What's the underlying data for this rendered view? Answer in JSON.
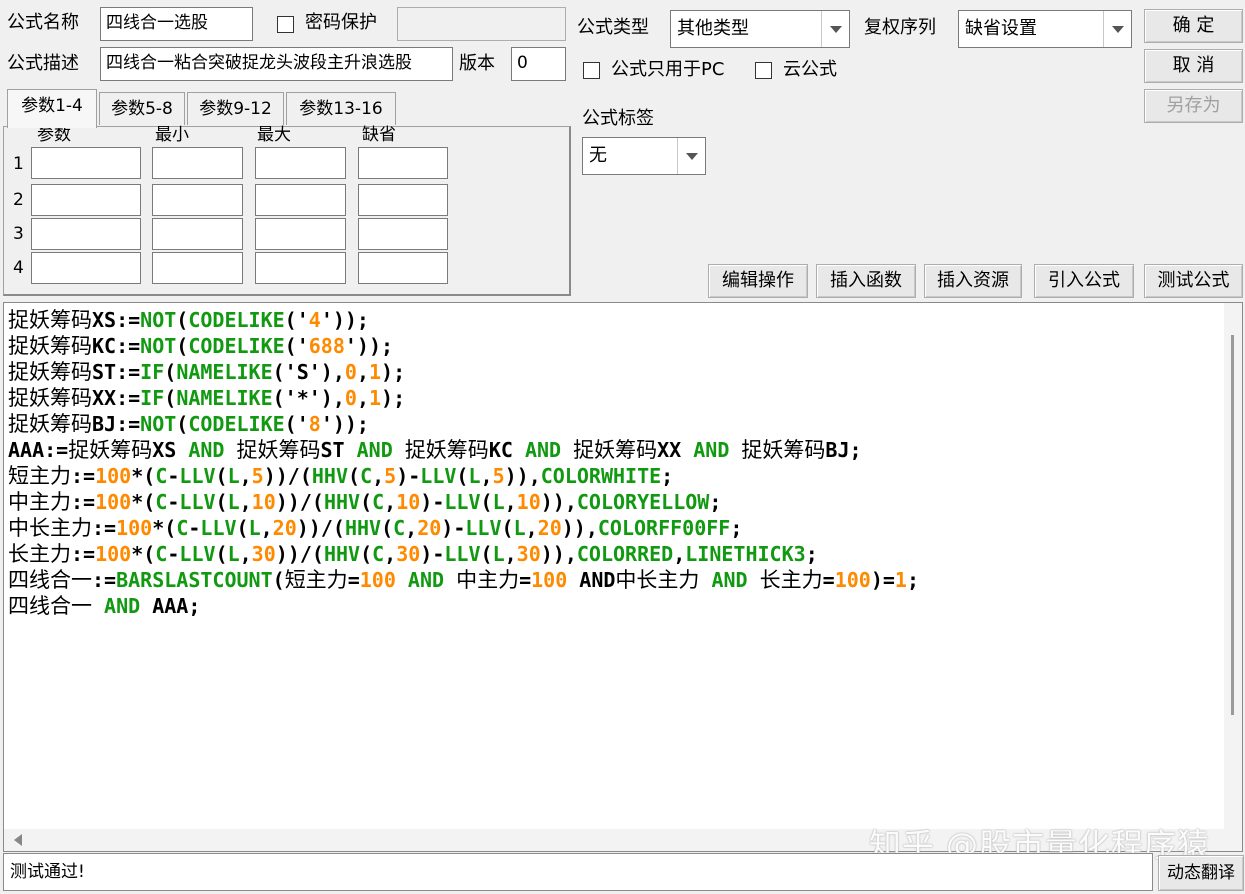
{
  "header": {
    "formula_name_label": "公式名称",
    "formula_name_value": "四线合一选股",
    "password_label": "密码保护",
    "formula_desc_label": "公式描述",
    "formula_desc_value": "四线合一粘合突破捉龙头波段主升浪选股",
    "version_label": "版本",
    "version_value": "0",
    "formula_type_label": "公式类型",
    "formula_type_value": "其他类型",
    "restoration_label": "复权序列",
    "restoration_value": "缺省设置",
    "pc_only_label": "公式只用于PC",
    "cloud_label": "云公式",
    "tag_label": "公式标签",
    "tag_value": "无"
  },
  "buttons": {
    "ok": "确 定",
    "cancel": "取 消",
    "save_as": "另存为",
    "edit_ops": "编辑操作",
    "insert_func": "插入函数",
    "insert_res": "插入资源",
    "import_formula": "引入公式",
    "test_formula": "测试公式",
    "dynamic_translate": "动态翻译"
  },
  "tabs": [
    "参数1-4",
    "参数5-8",
    "参数9-12",
    "参数13-16"
  ],
  "param_table": {
    "headers": [
      "参数",
      "最小",
      "最大",
      "缺省"
    ],
    "rows": [
      "1",
      "2",
      "3",
      "4"
    ]
  },
  "code_lines": [
    [
      [
        "cn",
        "捉妖筹码"
      ],
      [
        "t",
        "XS:="
      ],
      [
        "fn",
        "NOT"
      ],
      [
        "t",
        "("
      ],
      [
        "fn",
        "CODELIKE"
      ],
      [
        "t",
        "('"
      ],
      [
        "num",
        "4"
      ],
      [
        "t",
        "'));"
      ]
    ],
    [
      [
        "cn",
        "捉妖筹码"
      ],
      [
        "t",
        "KC:="
      ],
      [
        "fn",
        "NOT"
      ],
      [
        "t",
        "("
      ],
      [
        "fn",
        "CODELIKE"
      ],
      [
        "t",
        "('"
      ],
      [
        "num",
        "688"
      ],
      [
        "t",
        "'));"
      ]
    ],
    [
      [
        "cn",
        "捉妖筹码"
      ],
      [
        "t",
        "ST:="
      ],
      [
        "fn",
        "IF"
      ],
      [
        "t",
        "("
      ],
      [
        "fn",
        "NAMELIKE"
      ],
      [
        "t",
        "('S'),"
      ],
      [
        "num",
        "0"
      ],
      [
        "t",
        ","
      ],
      [
        "num",
        "1"
      ],
      [
        "t",
        ");"
      ]
    ],
    [
      [
        "cn",
        "捉妖筹码"
      ],
      [
        "t",
        "XX:="
      ],
      [
        "fn",
        "IF"
      ],
      [
        "t",
        "("
      ],
      [
        "fn",
        "NAMELIKE"
      ],
      [
        "t",
        "('*'),"
      ],
      [
        "num",
        "0"
      ],
      [
        "t",
        ","
      ],
      [
        "num",
        "1"
      ],
      [
        "t",
        ");"
      ]
    ],
    [
      [
        "cn",
        "捉妖筹码"
      ],
      [
        "t",
        "BJ:="
      ],
      [
        "fn",
        "NOT"
      ],
      [
        "t",
        "("
      ],
      [
        "fn",
        "CODELIKE"
      ],
      [
        "t",
        "('"
      ],
      [
        "num",
        "8"
      ],
      [
        "t",
        "'));"
      ]
    ],
    [
      [
        "t",
        "AAA:="
      ],
      [
        "cn",
        "捉妖筹码"
      ],
      [
        "t",
        "XS "
      ],
      [
        "fn",
        "AND"
      ],
      [
        "t",
        " "
      ],
      [
        "cn",
        "捉妖筹码"
      ],
      [
        "t",
        "ST "
      ],
      [
        "fn",
        "AND"
      ],
      [
        "t",
        " "
      ],
      [
        "cn",
        "捉妖筹码"
      ],
      [
        "t",
        "KC "
      ],
      [
        "fn",
        "AND"
      ],
      [
        "t",
        " "
      ],
      [
        "cn",
        "捉妖筹码"
      ],
      [
        "t",
        "XX "
      ],
      [
        "fn",
        "AND"
      ],
      [
        "t",
        " "
      ],
      [
        "cn",
        "捉妖筹码"
      ],
      [
        "t",
        "BJ;"
      ]
    ],
    [
      [
        "cn",
        "短主力"
      ],
      [
        "t",
        ":="
      ],
      [
        "num",
        "100"
      ],
      [
        "t",
        "*("
      ],
      [
        "fn",
        "C"
      ],
      [
        "t",
        "-"
      ],
      [
        "fn",
        "LLV"
      ],
      [
        "t",
        "("
      ],
      [
        "fn",
        "L"
      ],
      [
        "t",
        ","
      ],
      [
        "num",
        "5"
      ],
      [
        "t",
        "))/("
      ],
      [
        "fn",
        "HHV"
      ],
      [
        "t",
        "("
      ],
      [
        "fn",
        "C"
      ],
      [
        "t",
        ","
      ],
      [
        "num",
        "5"
      ],
      [
        "t",
        ")-"
      ],
      [
        "fn",
        "LLV"
      ],
      [
        "t",
        "("
      ],
      [
        "fn",
        "L"
      ],
      [
        "t",
        ","
      ],
      [
        "num",
        "5"
      ],
      [
        "t",
        "))"
      ],
      [
        "t",
        ","
      ],
      [
        "fn",
        "COLORWHITE"
      ],
      [
        "t",
        ";"
      ]
    ],
    [
      [
        "cn",
        "中主力"
      ],
      [
        "t",
        ":="
      ],
      [
        "num",
        "100"
      ],
      [
        "t",
        "*("
      ],
      [
        "fn",
        "C"
      ],
      [
        "t",
        "-"
      ],
      [
        "fn",
        "LLV"
      ],
      [
        "t",
        "("
      ],
      [
        "fn",
        "L"
      ],
      [
        "t",
        ","
      ],
      [
        "num",
        "10"
      ],
      [
        "t",
        "))/("
      ],
      [
        "fn",
        "HHV"
      ],
      [
        "t",
        "("
      ],
      [
        "fn",
        "C"
      ],
      [
        "t",
        ","
      ],
      [
        "num",
        "10"
      ],
      [
        "t",
        ")-"
      ],
      [
        "fn",
        "LLV"
      ],
      [
        "t",
        "("
      ],
      [
        "fn",
        "L"
      ],
      [
        "t",
        ","
      ],
      [
        "num",
        "10"
      ],
      [
        "t",
        "))"
      ],
      [
        "t",
        ","
      ],
      [
        "fn",
        "COLORYELLOW"
      ],
      [
        "t",
        ";"
      ]
    ],
    [
      [
        "cn",
        "中长主力"
      ],
      [
        "t",
        ":="
      ],
      [
        "num",
        "100"
      ],
      [
        "t",
        "*("
      ],
      [
        "fn",
        "C"
      ],
      [
        "t",
        "-"
      ],
      [
        "fn",
        "LLV"
      ],
      [
        "t",
        "("
      ],
      [
        "fn",
        "L"
      ],
      [
        "t",
        ","
      ],
      [
        "num",
        "20"
      ],
      [
        "t",
        "))/("
      ],
      [
        "fn",
        "HHV"
      ],
      [
        "t",
        "("
      ],
      [
        "fn",
        "C"
      ],
      [
        "t",
        ","
      ],
      [
        "num",
        "20"
      ],
      [
        "t",
        ")-"
      ],
      [
        "fn",
        "LLV"
      ],
      [
        "t",
        "("
      ],
      [
        "fn",
        "L"
      ],
      [
        "t",
        ","
      ],
      [
        "num",
        "20"
      ],
      [
        "t",
        "))"
      ],
      [
        "t",
        ","
      ],
      [
        "fn",
        "COLORFF00FF"
      ],
      [
        "t",
        ";"
      ]
    ],
    [
      [
        "cn",
        "长主力"
      ],
      [
        "t",
        ":="
      ],
      [
        "num",
        "100"
      ],
      [
        "t",
        "*("
      ],
      [
        "fn",
        "C"
      ],
      [
        "t",
        "-"
      ],
      [
        "fn",
        "LLV"
      ],
      [
        "t",
        "("
      ],
      [
        "fn",
        "L"
      ],
      [
        "t",
        ","
      ],
      [
        "num",
        "30"
      ],
      [
        "t",
        "))/("
      ],
      [
        "fn",
        "HHV"
      ],
      [
        "t",
        "("
      ],
      [
        "fn",
        "C"
      ],
      [
        "t",
        ","
      ],
      [
        "num",
        "30"
      ],
      [
        "t",
        ")-"
      ],
      [
        "fn",
        "LLV"
      ],
      [
        "t",
        "("
      ],
      [
        "fn",
        "L"
      ],
      [
        "t",
        ","
      ],
      [
        "num",
        "30"
      ],
      [
        "t",
        "))"
      ],
      [
        "t",
        ","
      ],
      [
        "fn",
        "COLORRED"
      ],
      [
        "t",
        ","
      ],
      [
        "fn",
        "LINETHICK3"
      ],
      [
        "t",
        ";"
      ]
    ],
    [
      [
        "cn",
        "四线合一"
      ],
      [
        "t",
        ":="
      ],
      [
        "fn",
        "BARSLASTCOUNT"
      ],
      [
        "t",
        "("
      ],
      [
        "cn",
        "短主力"
      ],
      [
        "t",
        "="
      ],
      [
        "num",
        "100"
      ],
      [
        "t",
        " "
      ],
      [
        "fn",
        "AND"
      ],
      [
        "t",
        " "
      ],
      [
        "cn",
        "中主力"
      ],
      [
        "t",
        "="
      ],
      [
        "num",
        "100"
      ],
      [
        "t",
        " AND"
      ],
      [
        "cn",
        "中长主力"
      ],
      [
        "t",
        " "
      ],
      [
        "fn",
        "AND"
      ],
      [
        "t",
        " "
      ],
      [
        "cn",
        "长主力"
      ],
      [
        "t",
        "="
      ],
      [
        "num",
        "100"
      ],
      [
        "t",
        ")="
      ],
      [
        "num",
        "1"
      ],
      [
        "t",
        ";"
      ]
    ],
    [
      [
        "cn",
        "四线合一"
      ],
      [
        "t",
        " "
      ],
      [
        "fn",
        "AND"
      ],
      [
        "t",
        " AAA;"
      ]
    ]
  ],
  "watermark": "知乎 @股市量化程序猿",
  "status": "测试通过!",
  "colors": {
    "function": "#119911",
    "number": "#ff8a00"
  }
}
